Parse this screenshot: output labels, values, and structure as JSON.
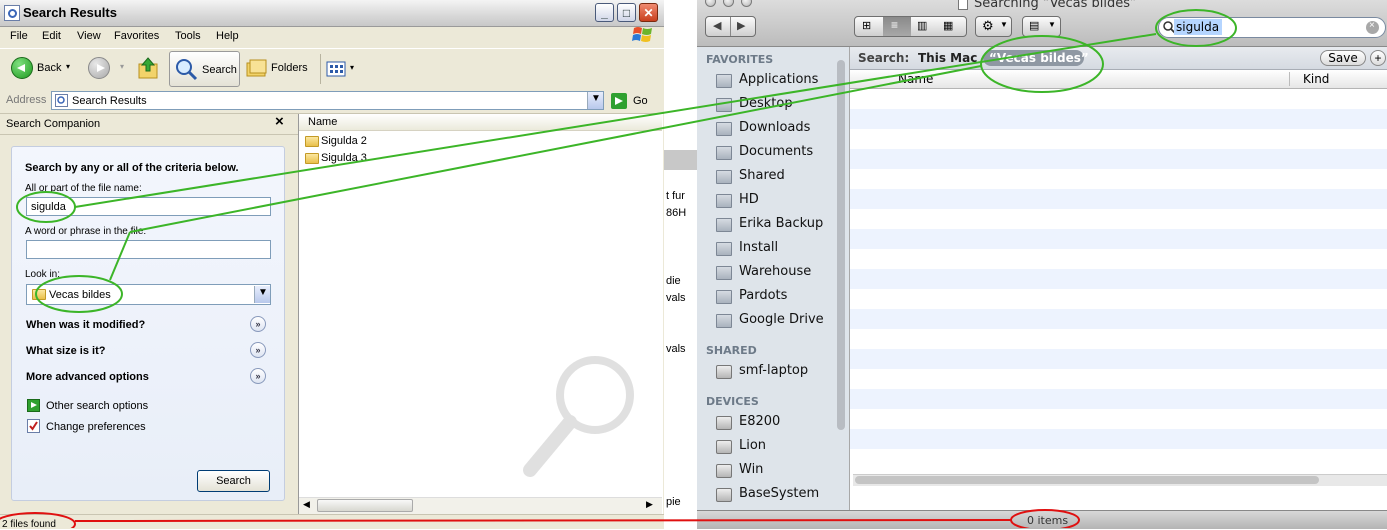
{
  "xp": {
    "title": "Search Results",
    "menu": [
      "File",
      "Edit",
      "View",
      "Favorites",
      "Tools",
      "Help"
    ],
    "toolbar": {
      "back": "Back",
      "search": "Search",
      "folders": "Folders"
    },
    "address": {
      "label": "Address",
      "value": "Search Results",
      "go": "Go"
    },
    "companion": {
      "header": "Search Companion",
      "close": "×",
      "heading": "Search by any or all of the criteria below.",
      "filename_label": "All or part of the file name:",
      "filename_value": "sigulda",
      "phrase_label": "A word or phrase in the file:",
      "phrase_value": "",
      "lookin_label": "Look in:",
      "lookin_value": "Vecas bildes",
      "sections": [
        "When was it modified?",
        "What size is it?",
        "More advanced options"
      ],
      "links": [
        "Other search options",
        "Change preferences"
      ],
      "search_button": "Search"
    },
    "files": {
      "column": "Name",
      "items": [
        "Sigulda 2",
        "Sigulda 3"
      ]
    },
    "status": "2 files found"
  },
  "background": {
    "fragments": [
      "t fur",
      "86H",
      "die",
      "vals",
      "vals",
      "pie"
    ]
  },
  "mac": {
    "title": "Searching “Vecas bildes”",
    "search_value": "sigulda",
    "scope": {
      "label": "Search:",
      "this_mac": "This Mac",
      "folder": "“Vecas bildes”",
      "save": "Save",
      "add": "+"
    },
    "columns": [
      "Name",
      "Kind"
    ],
    "sidebar": {
      "favorites_header": "FAVORITES",
      "favorites": [
        {
          "label": "Applications",
          "icon": "applications-icon"
        },
        {
          "label": "Desktop",
          "icon": "desktop-icon"
        },
        {
          "label": "Downloads",
          "icon": "downloads-icon"
        },
        {
          "label": "Documents",
          "icon": "documents-icon"
        },
        {
          "label": "Shared",
          "icon": "folder-icon"
        },
        {
          "label": "HD",
          "icon": "folder-icon"
        },
        {
          "label": "Erika Backup",
          "icon": "folder-icon"
        },
        {
          "label": "Install",
          "icon": "folder-icon"
        },
        {
          "label": "Warehouse",
          "icon": "folder-icon"
        },
        {
          "label": "Pardots",
          "icon": "folder-icon"
        },
        {
          "label": "Google Drive",
          "icon": "folder-icon"
        }
      ],
      "shared_header": "SHARED",
      "shared": [
        {
          "label": "smf-laptop",
          "icon": "computer-icon"
        }
      ],
      "devices_header": "DEVICES",
      "devices": [
        {
          "label": "E8200",
          "icon": "disk-icon"
        },
        {
          "label": "Lion",
          "icon": "disk-icon"
        },
        {
          "label": "Win",
          "icon": "disk-icon"
        },
        {
          "label": "BaseSystem",
          "icon": "disk-icon"
        }
      ]
    },
    "status": "0 items"
  },
  "colors": {
    "annotation_green": "#3cb528",
    "annotation_red": "#e01010",
    "xp_chrome": "#ece9d8",
    "mac_sidebar": "#dee4ea"
  }
}
